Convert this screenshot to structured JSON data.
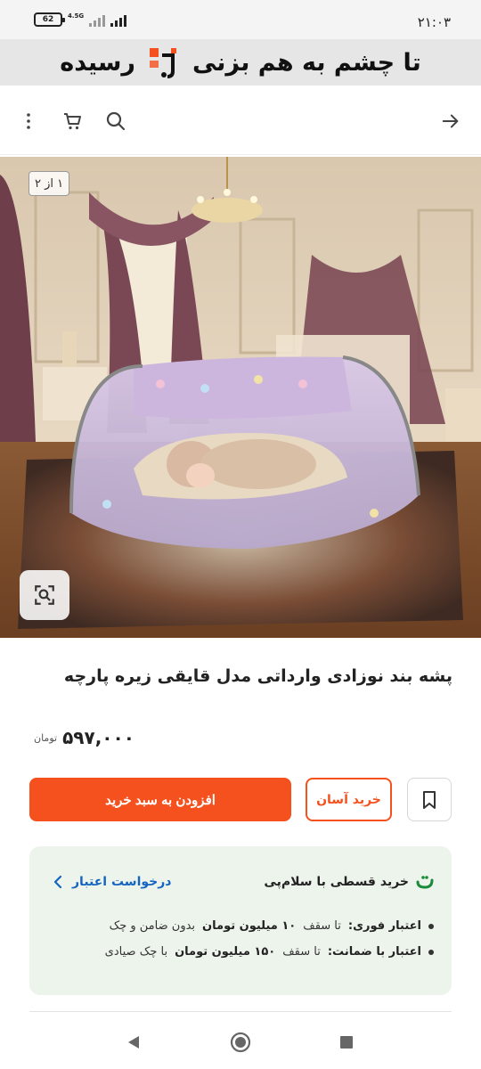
{
  "status": {
    "battery": "62",
    "network": "4.5G",
    "time": "۲۱:۰۳"
  },
  "banner": {
    "text_start": "تا چشم به هم بزنی",
    "text_end": "رسیده",
    "logo_icon": "digikala-jet-logo"
  },
  "toolbar": {
    "back_icon": "arrow-right-icon",
    "search_icon": "search-icon",
    "cart_icon": "cart-icon",
    "more_icon": "more-vertical-icon"
  },
  "gallery": {
    "counter": "۱ از ۲",
    "zoom_icon": "image-search-icon"
  },
  "product": {
    "title": "پشه بند نوزادی وارداتی مدل قایقی زیره پارچه",
    "price": "۵۹۷,۰۰۰",
    "currency": "تومان"
  },
  "actions": {
    "add_to_cart": "افزودن به سبد خرید",
    "easy_buy": "خرید آسان"
  },
  "installment": {
    "title": "خرید قسطی با سلام‌پی",
    "link": "درخواست اعتبار",
    "items": [
      {
        "label": "اعتبار فوری:",
        "pre": "تا سقف",
        "bold": "۱۰ میلیون تومان",
        "post": "بدون ضامن و چک"
      },
      {
        "label": "اعتبار با ضمانت:",
        "pre": "تا سقف",
        "bold": "۱۵۰ میلیون تومان",
        "post": "با چک صیادی"
      }
    ]
  },
  "colors": {
    "accent": "#f4511e",
    "link": "#1565c0",
    "card_bg": "#edf4ec",
    "brand_green": "#1b8a3a"
  }
}
